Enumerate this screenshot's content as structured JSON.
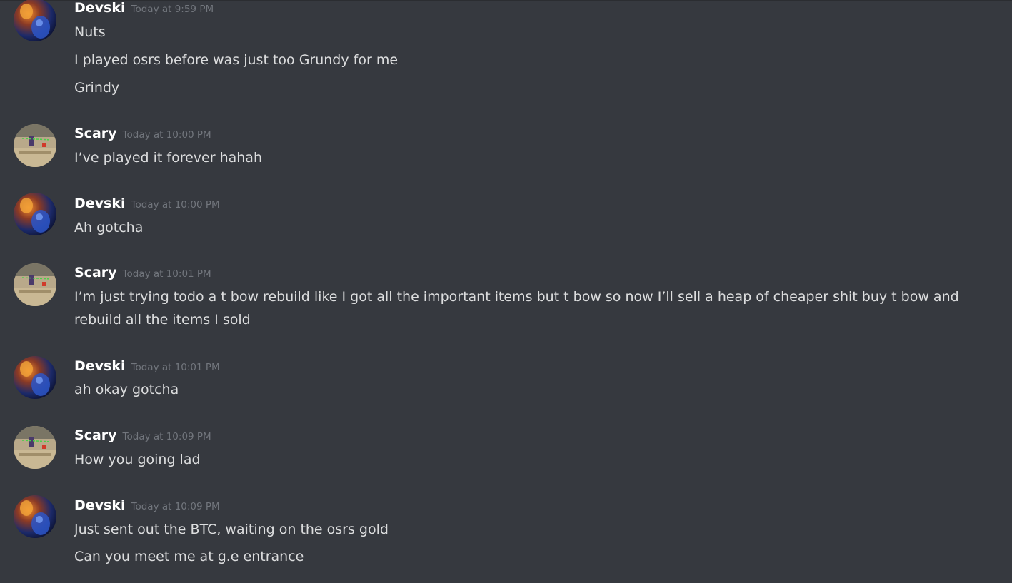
{
  "messages": [
    {
      "author": "Devski",
      "timestamp": "Today at 9:59 PM",
      "avatar": "devski-avatar",
      "lines": [
        "Nuts",
        "I played osrs before was just too Grundy for me",
        "Grindy"
      ]
    },
    {
      "author": "Scary",
      "timestamp": "Today at 10:00 PM",
      "avatar": "scary-avatar",
      "lines": [
        "I’ve played it forever hahah"
      ]
    },
    {
      "author": "Devski",
      "timestamp": "Today at 10:00 PM",
      "avatar": "devski-avatar",
      "lines": [
        "Ah gotcha"
      ]
    },
    {
      "author": "Scary",
      "timestamp": "Today at 10:01 PM",
      "avatar": "scary-avatar",
      "lines": [
        "I’m just trying todo a t bow rebuild like I got all the important items but t bow so now I’ll sell a heap of cheaper shit buy t bow and rebuild all the items I sold"
      ]
    },
    {
      "author": "Devski",
      "timestamp": "Today at 10:01 PM",
      "avatar": "devski-avatar",
      "lines": [
        "ah okay gotcha"
      ]
    },
    {
      "author": "Scary",
      "timestamp": "Today at 10:09 PM",
      "avatar": "scary-avatar",
      "lines": [
        "How you going lad"
      ]
    },
    {
      "author": "Devski",
      "timestamp": "Today at 10:09 PM",
      "avatar": "devski-avatar",
      "lines": [
        "Just sent out the BTC, waiting on the osrs gold",
        "Can you meet me at g.e entrance"
      ]
    }
  ],
  "colors": {
    "background": "#36393f",
    "username": "#ffffff",
    "message_text": "#dcddde",
    "timestamp": "#72767d"
  }
}
